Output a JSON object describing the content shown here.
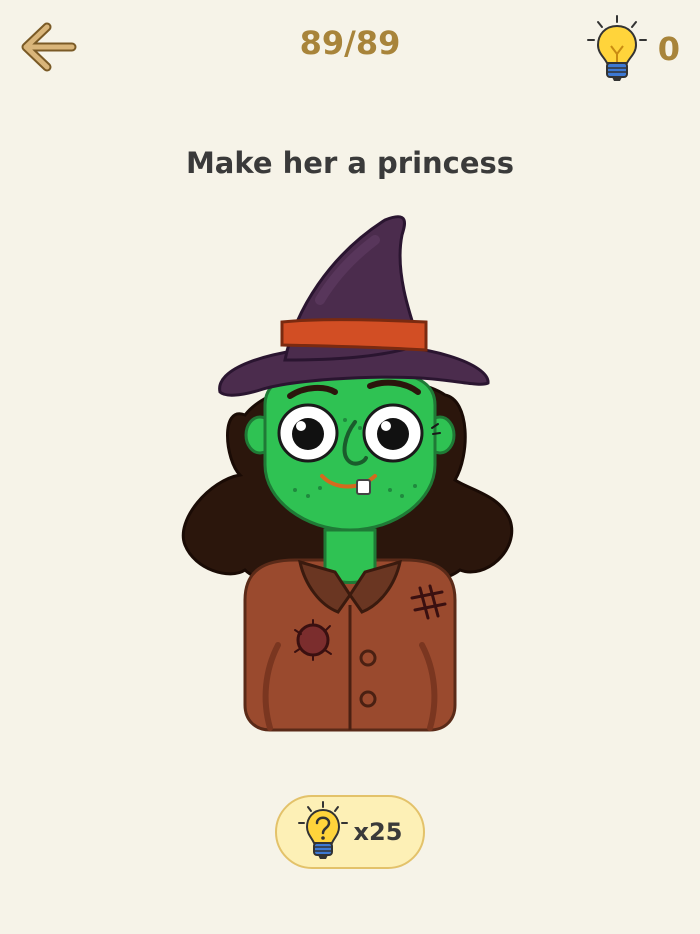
{
  "header": {
    "level_progress": "89/89",
    "hint_count": "0"
  },
  "prompt": {
    "instruction": "Make her a princess"
  },
  "hint_button": {
    "cost_label": "x25"
  },
  "icons": {
    "back": "arrow-left-icon",
    "hint": "lightbulb-icon",
    "hint_question": "lightbulb-question-icon"
  },
  "colors": {
    "background": "#f6f3e8",
    "accent": "#a8843a",
    "hint_button_bg": "#fdf0b6",
    "skin": "#2fc253",
    "hat": "#4b2c4d",
    "hat_band": "#d24e24",
    "hair": "#2b160c",
    "shirt": "#9a4a2e"
  }
}
